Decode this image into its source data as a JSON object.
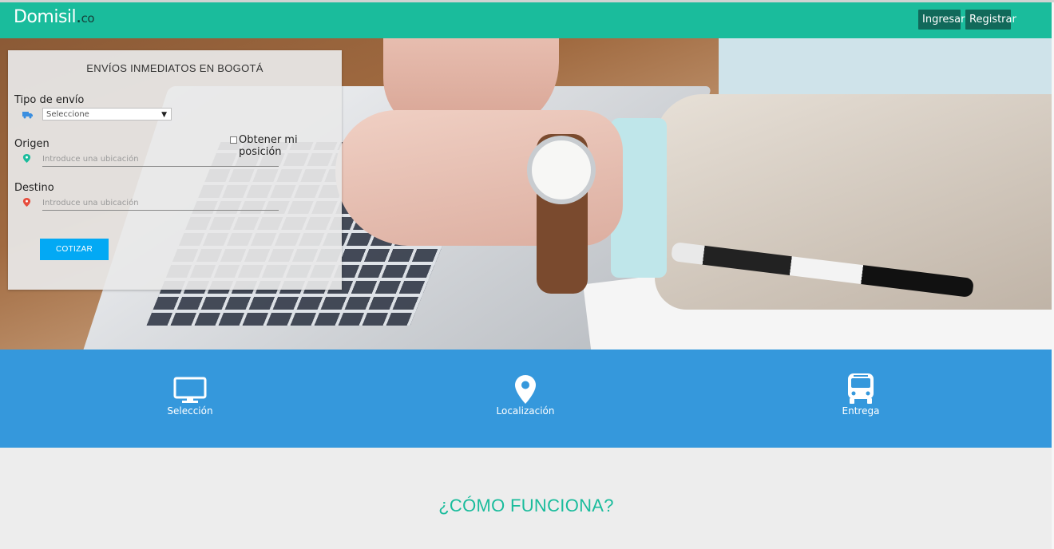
{
  "navbar": {
    "brand_name": "Domisil",
    "brand_dot": ".",
    "brand_tld": "co",
    "login_label": "Ingresar",
    "register_label": "Registrar",
    "color": "#1abc9c"
  },
  "quote_form": {
    "title": "ENVÍOS INMEDIATOS EN BOGOTÁ",
    "shipping_type_label": "Tipo de envío",
    "shipping_type_value": "Seleccione",
    "origin_label": "Origen",
    "origin_placeholder": "Introduce una ubicación",
    "destination_label": "Destino",
    "destination_placeholder": "Introduce una ubicación",
    "get_position_label": "Obtener mi posición",
    "quote_button": "COTIZAR",
    "button_color": "#03a9f4"
  },
  "features": {
    "color": "#3598dc",
    "items": [
      {
        "icon": "monitor-icon",
        "label": "Selección"
      },
      {
        "icon": "map-pin-icon",
        "label": "Localización"
      },
      {
        "icon": "bus-icon",
        "label": "Entrega"
      }
    ]
  },
  "how_it_works": {
    "title": "¿CÓMO FUNCIONA?"
  }
}
